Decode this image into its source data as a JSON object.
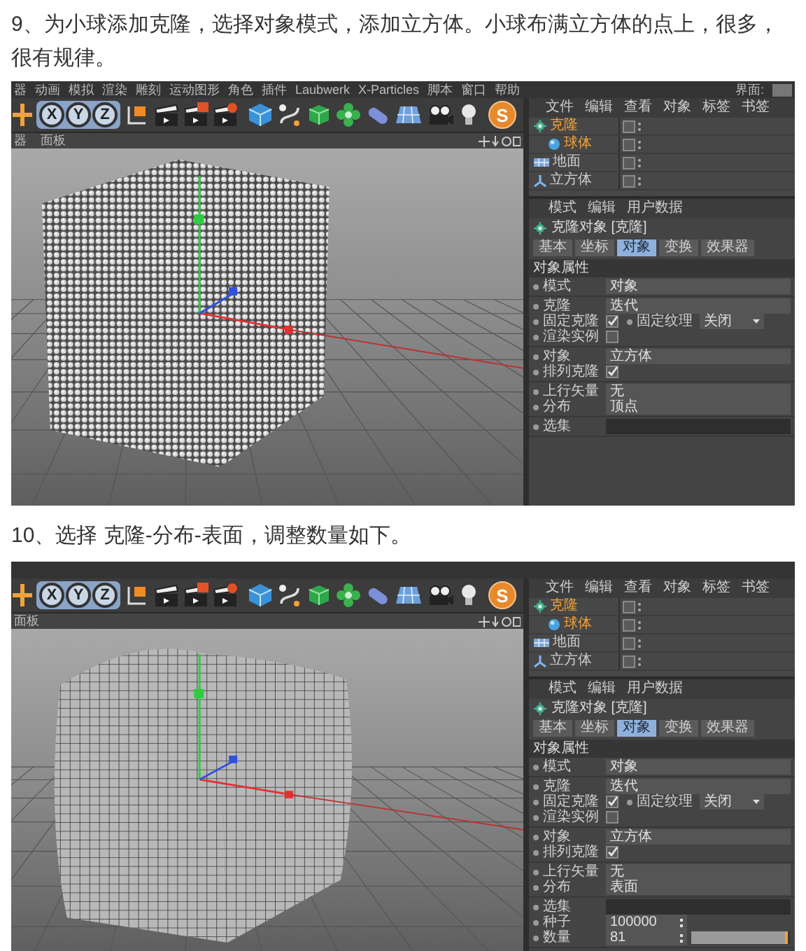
{
  "steps": [
    {
      "caption": "9、为小球添加克隆，选择对象模式，添加立方体。小球布满立方体的点上，很多，很有规律。",
      "screenshot": {
        "menu_items": [
          "器",
          "动画",
          "模拟",
          "渲染",
          "雕刻",
          "运动图形",
          "角色",
          "插件",
          "Laubwerk",
          "X-Particles",
          "脚本",
          "窗口",
          "帮助"
        ],
        "layout_label": "界面:",
        "axis_buttons": [
          "X",
          "Y",
          "Z"
        ],
        "s_button": "S",
        "viewport_menu": [
          "器",
          "面板"
        ],
        "object_menu": [
          "文件",
          "编辑",
          "查看",
          "对象",
          "标签",
          "书签"
        ],
        "objects": [
          {
            "name": "克隆",
            "kind": "cloner",
            "highlighted": true,
            "children": [
              {
                "name": "球体",
                "kind": "sphere",
                "highlighted": true
              }
            ]
          },
          {
            "name": "地面",
            "kind": "floor",
            "highlighted": false
          },
          {
            "name": "立方体",
            "kind": "cube",
            "highlighted": false
          }
        ],
        "attr_menu": [
          "模式",
          "编辑",
          "用户数据"
        ],
        "attr_title": "克隆对象 [克隆]",
        "attr_tabs": [
          {
            "label": "基本",
            "selected": false
          },
          {
            "label": "坐标",
            "selected": false
          },
          {
            "label": "对象",
            "selected": true
          },
          {
            "label": "变换",
            "selected": false
          },
          {
            "label": "效果器",
            "selected": false
          }
        ],
        "section": "对象属性",
        "groups": [
          [
            [
              {
                "kind": "dropdown",
                "label": "模式",
                "value": "对象"
              }
            ]
          ],
          [
            [
              {
                "kind": "dropdown",
                "label": "克隆",
                "value": "迭代"
              }
            ],
            [
              {
                "kind": "check",
                "label": "固定克隆",
                "checked": true
              },
              {
                "kind": "short_dropdown",
                "label": "固定纹理",
                "value": "关闭"
              }
            ],
            [
              {
                "kind": "check",
                "label": "渲染实例",
                "checked": false
              }
            ]
          ],
          [
            [
              {
                "kind": "dropdown",
                "label": "对象",
                "value": "立方体"
              }
            ],
            [
              {
                "kind": "check",
                "label": "排列克隆",
                "checked": true
              }
            ]
          ],
          [
            [
              {
                "kind": "dropdown",
                "label": "上行矢量",
                "value": "无"
              }
            ],
            [
              {
                "kind": "dropdown",
                "label": "分布",
                "value": "顶点"
              }
            ]
          ],
          [
            [
              {
                "kind": "dropdown",
                "label": "选集"
              }
            ]
          ]
        ]
      }
    },
    {
      "caption": "10、选择 克隆-分布-表面，调整数量如下。",
      "screenshot": {
        "axis_buttons": [
          "X",
          "Y",
          "Z"
        ],
        "s_button": "S",
        "viewport_menu": [
          "面板"
        ],
        "object_menu": [
          "文件",
          "编辑",
          "查看",
          "对象",
          "标签",
          "书签"
        ],
        "objects": [
          {
            "name": "克隆",
            "kind": "cloner",
            "highlighted": true,
            "children": [
              {
                "name": "球体",
                "kind": "sphere",
                "highlighted": true
              }
            ]
          },
          {
            "name": "地面",
            "kind": "floor",
            "highlighted": false
          },
          {
            "name": "立方体",
            "kind": "cube",
            "highlighted": false
          }
        ],
        "attr_menu": [
          "模式",
          "编辑",
          "用户数据"
        ],
        "attr_title": "克隆对象 [克隆]",
        "attr_tabs": [
          {
            "label": "基本",
            "selected": false
          },
          {
            "label": "坐标",
            "selected": false
          },
          {
            "label": "对象",
            "selected": true
          },
          {
            "label": "变换",
            "selected": false
          },
          {
            "label": "效果器",
            "selected": false
          }
        ],
        "section": "对象属性",
        "groups": [
          [
            [
              {
                "kind": "dropdown",
                "label": "模式",
                "value": "对象"
              }
            ]
          ],
          [
            [
              {
                "kind": "dropdown",
                "label": "克隆",
                "value": "迭代"
              }
            ],
            [
              {
                "kind": "check",
                "label": "固定克隆",
                "checked": true
              },
              {
                "kind": "short_dropdown",
                "label": "固定纹理",
                "value": "关闭"
              }
            ],
            [
              {
                "kind": "check",
                "label": "渲染实例",
                "checked": false
              }
            ]
          ],
          [
            [
              {
                "kind": "dropdown",
                "label": "对象",
                "value": "立方体"
              }
            ],
            [
              {
                "kind": "check",
                "label": "排列克隆",
                "checked": true
              }
            ]
          ],
          [
            [
              {
                "kind": "dropdown",
                "label": "上行矢量",
                "value": "无"
              }
            ],
            [
              {
                "kind": "dropdown",
                "label": "分布",
                "value": "表面"
              }
            ]
          ],
          [
            [
              {
                "kind": "dropdown",
                "label": "选集"
              }
            ],
            [
              {
                "kind": "number",
                "label": "种子",
                "value": "100000"
              }
            ],
            [
              {
                "kind": "slider",
                "label": "数量",
                "value": "81",
                "level": 0.97
              }
            ]
          ]
        ]
      }
    }
  ]
}
